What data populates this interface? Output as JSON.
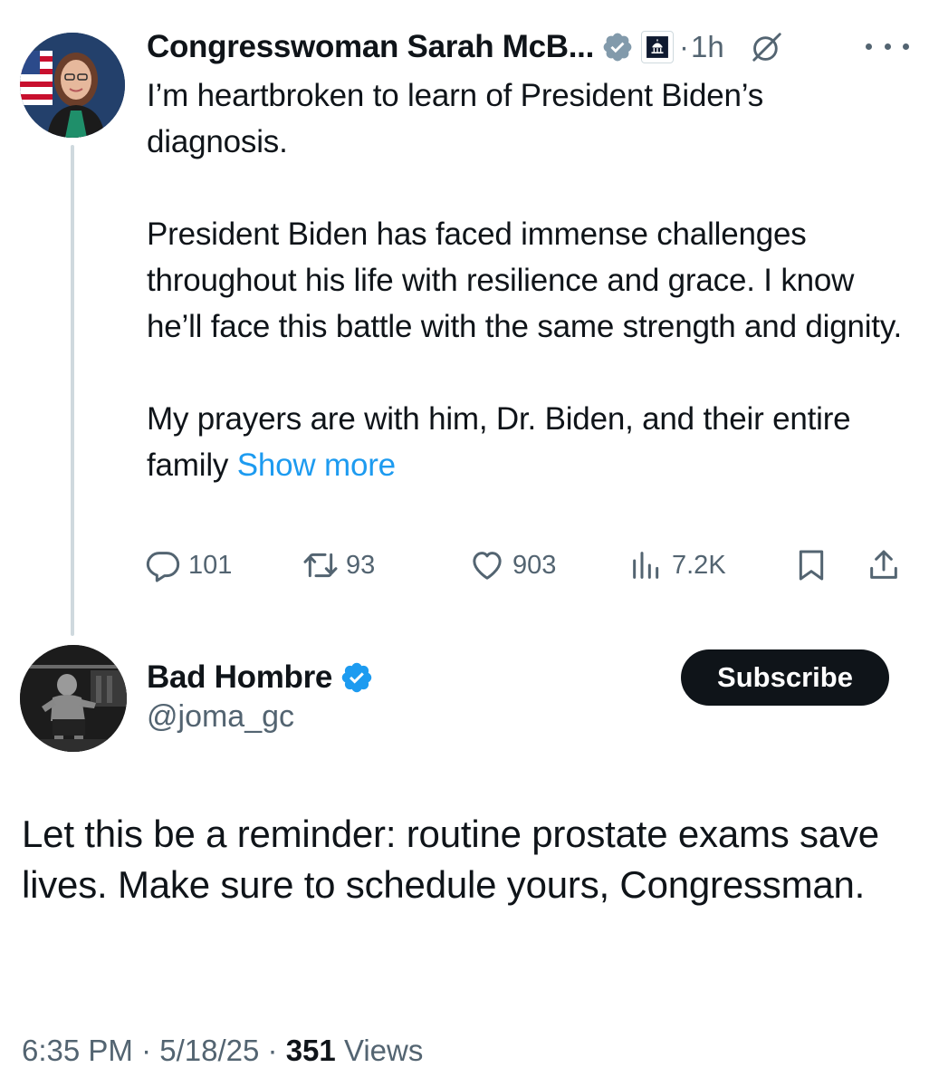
{
  "parent_tweet": {
    "author_name": "Congresswoman Sarah McB...",
    "time": "1h",
    "dot": "·",
    "paragraphs": [
      "I’m heartbroken to learn of President Biden’s diagnosis.",
      "President Biden has faced immense challenges throughout his life with resilience and grace. I know he’ll face this battle with the same strength and dignity.",
      "My prayers are with him, Dr. Biden, and their entire family"
    ],
    "show_more": "Show more",
    "stats": {
      "replies": "101",
      "reposts": "93",
      "likes": "903",
      "views": "7.2K"
    },
    "icons": {
      "verified": "gray-verified-badge-icon",
      "affiliate": "capitol-affiliate-icon",
      "grok": "grok-icon",
      "more": "more-dots-icon",
      "reply": "reply-bubble-icon",
      "repost": "repost-arrows-icon",
      "like": "heart-icon",
      "views": "analytics-bars-icon",
      "bookmark": "bookmark-icon",
      "share": "share-upload-icon"
    }
  },
  "reply_tweet": {
    "author_name": "Bad Hombre",
    "handle": "@joma_gc",
    "subscribe_label": "Subscribe",
    "text": "Let this be a reminder: routine prostate exams save lives. Make sure to schedule yours, Congressman.",
    "meta": {
      "time": "6:35 PM",
      "date": "5/18/25",
      "separator": "·",
      "views_count": "351",
      "views_label": "Views"
    },
    "icons": {
      "verified": "blue-verified-badge-icon"
    }
  },
  "colors": {
    "text": "#0f1419",
    "secondary": "#536471",
    "link": "#1d9bf0",
    "verified_blue": "#1d9bf0",
    "verified_gray": "#829aab",
    "subscribe_bg": "#0f1419",
    "thread_line": "#cfd9de"
  }
}
